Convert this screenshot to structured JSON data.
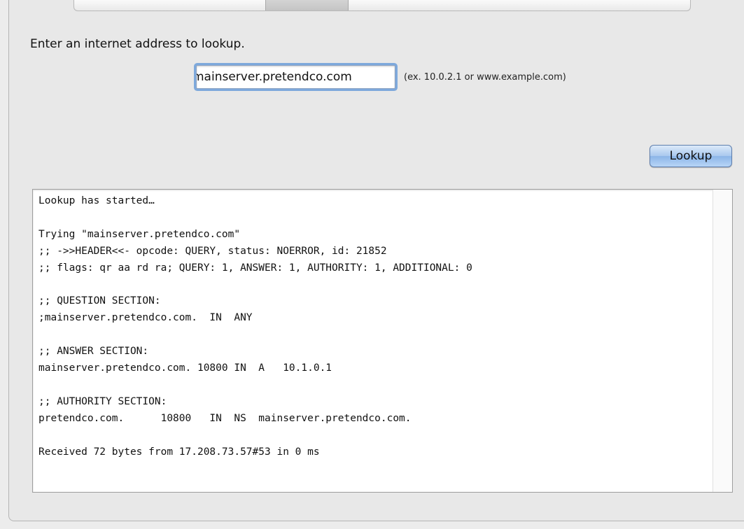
{
  "lookup": {
    "prompt": "Enter an internet address to lookup.",
    "address_value": "mainserver.pretendco.com",
    "hint": "(ex. 10.0.2.1 or www.example.com)",
    "button_label": "Lookup"
  },
  "output": {
    "lines": [
      "Lookup has started…",
      "",
      "Trying \"mainserver.pretendco.com\"",
      ";; ->>HEADER<<- opcode: QUERY, status: NOERROR, id: 21852",
      ";; flags: qr aa rd ra; QUERY: 1, ANSWER: 1, AUTHORITY: 1, ADDITIONAL: 0",
      "",
      ";; QUESTION SECTION:",
      ";mainserver.pretendco.com.  IN  ANY",
      "",
      ";; ANSWER SECTION:",
      "mainserver.pretendco.com. 10800 IN  A   10.1.0.1",
      "",
      ";; AUTHORITY SECTION:",
      "pretendco.com.      10800   IN  NS  mainserver.pretendco.com.",
      "",
      "Received 72 bytes from 17.208.73.57#53 in 0 ms"
    ]
  }
}
